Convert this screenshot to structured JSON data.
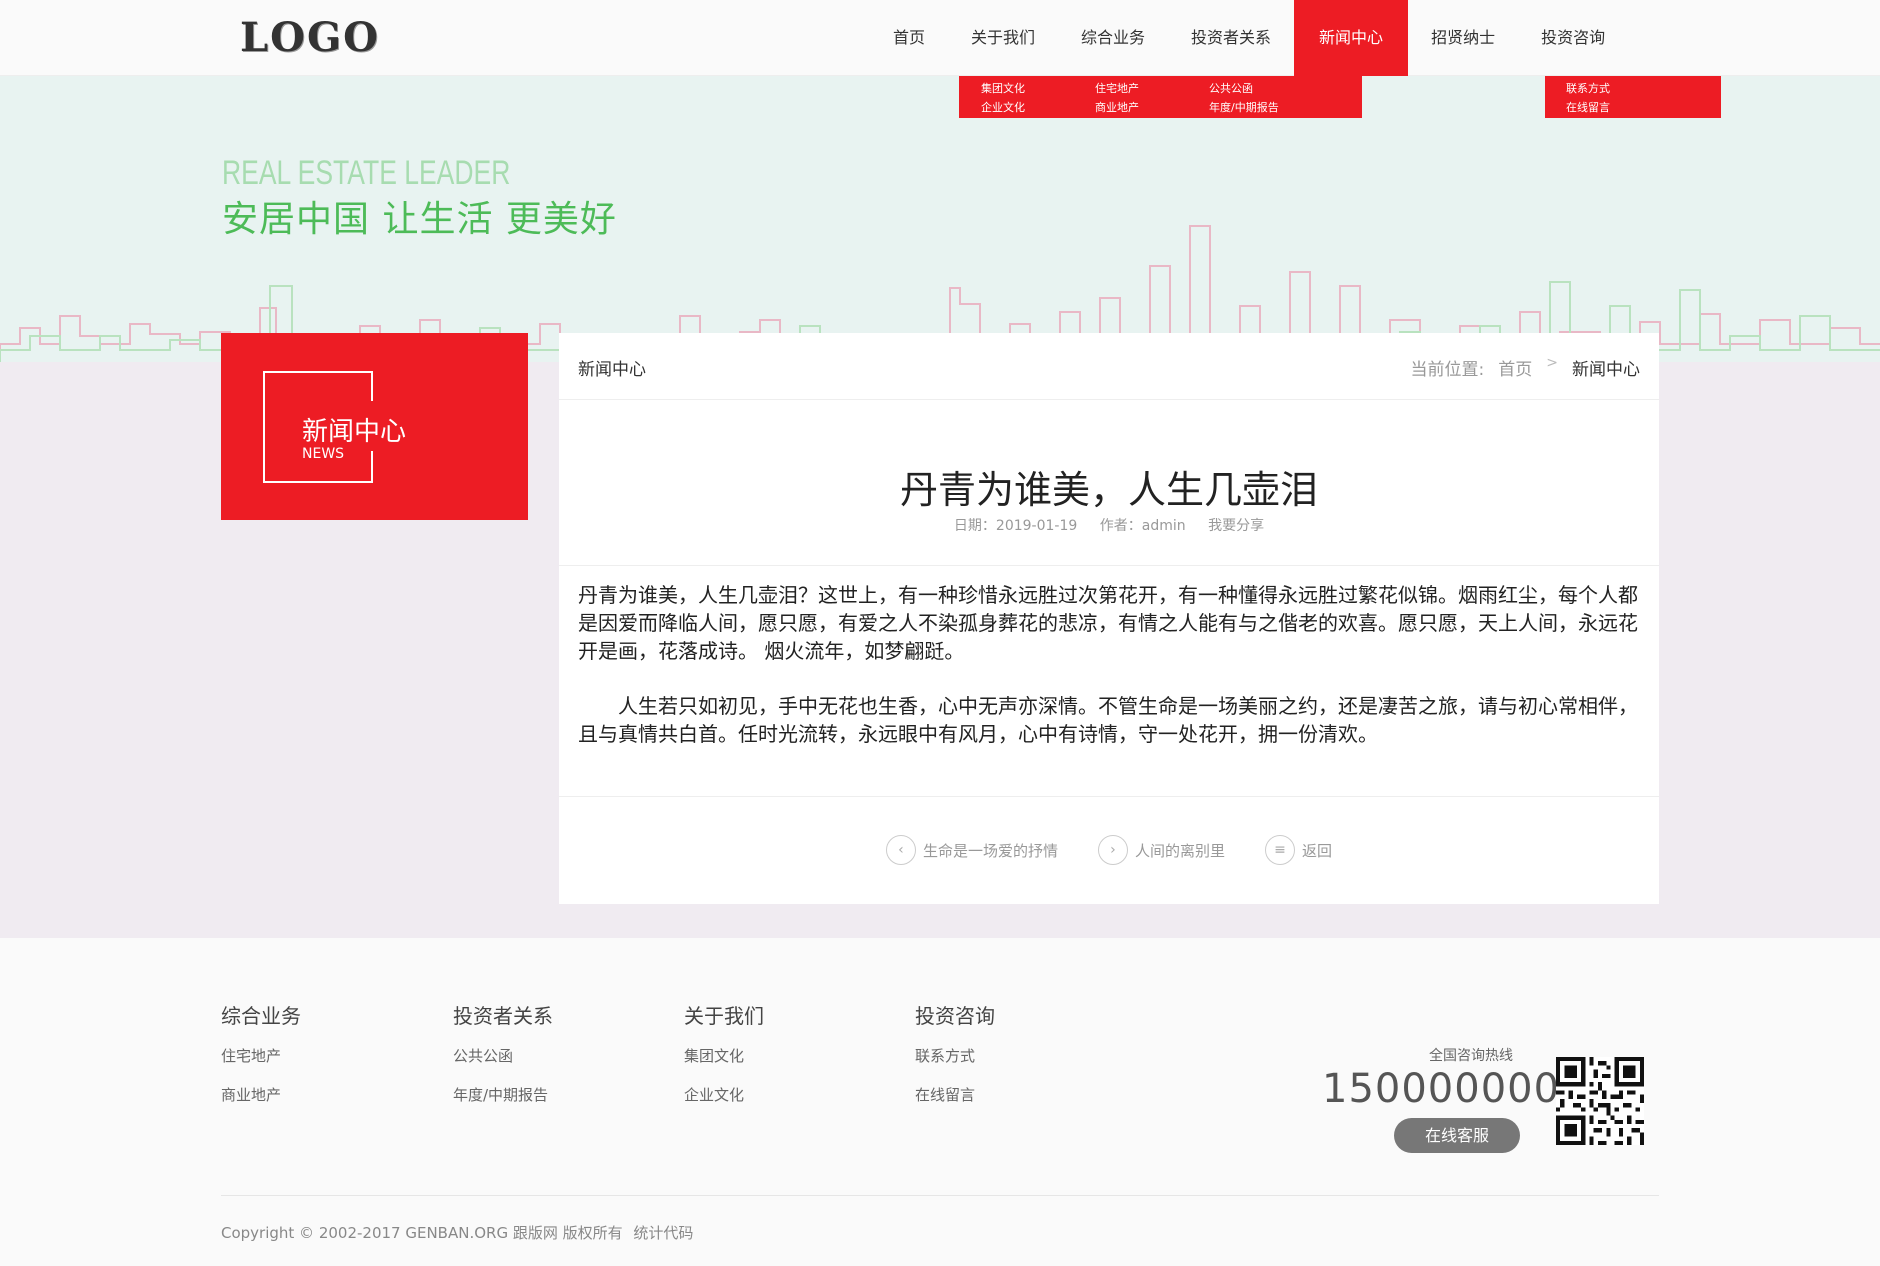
{
  "header": {
    "logo": "LOGO",
    "nav": [
      "首页",
      "关于我们",
      "综合业务",
      "投资者关系",
      "新闻中心",
      "招贤纳士",
      "投资咨询"
    ],
    "active": "新闻中心",
    "dropdown_main": [
      "集团文化",
      "住宅地产",
      "公共公函",
      "企业文化",
      "商业地产",
      "年度/中期报告"
    ],
    "dropdown_right": [
      "联系方式",
      "在线留言"
    ]
  },
  "banner": {
    "en": "REAL ESTATE LEADER",
    "zh": "安居中国 让生活 更美好"
  },
  "side": {
    "title": "新闻中心",
    "subtitle": "NEWS"
  },
  "content": {
    "head_title": "新闻中心",
    "crumb_label": "当前位置:",
    "crumb_home": "首页",
    "crumb_sep": ">",
    "crumb_current": "新闻中心",
    "article_title": "丹青为谁美，人生几壶泪",
    "meta_date": "日期：2019-01-19",
    "meta_author": "作者：admin",
    "meta_share": "我要分享",
    "paragraphs": [
      "丹青为谁美，人生几壶泪？这世上，有一种珍惜永远胜过次第花开，有一种懂得永远胜过繁花似锦。烟雨红尘，每个人都是因爱而降临人间，愿只愿，有爱之人不染孤身葬花的悲凉，有情之人能有与之偕老的欢喜。愿只愿，天上人间，永远花开是画，花落成诗。 烟火流年，如梦翩跹。",
      "　　人生若只如初见，手中无花也生香，心中无声亦深情。不管生命是一场美丽之约，还是凄苦之旅，请与初心常相伴，且与真情共白首。任时光流转，永远眼中有风月，心中有诗情，守一处花开，拥一份清欢。"
    ],
    "prev_label": "生命是一场爱的抒情",
    "next_label": "人间的离别里",
    "back_label": "返回"
  },
  "footer": {
    "columns": [
      {
        "title": "综合业务",
        "links": [
          "住宅地产",
          "商业地产"
        ]
      },
      {
        "title": "投资者关系",
        "links": [
          "公共公函",
          "年度/中期报告"
        ]
      },
      {
        "title": "关于我们",
        "links": [
          "集团文化",
          "企业文化"
        ]
      },
      {
        "title": "投资咨询",
        "links": [
          "联系方式",
          "在线留言"
        ]
      }
    ],
    "hotline_label": "全国咨询热线",
    "hotline_number": "150000000",
    "service_button": "在线客服",
    "copyright": "Copyright © 2002-2017 GENBAN.ORG 跟版网 版权所有",
    "stats_link": "统计代码"
  },
  "colors": {
    "accent": "#ed1c24",
    "banner_green": "#4dbb58",
    "banner_bg": "#e8f3f1",
    "page_bg": "#f0ebf1"
  }
}
